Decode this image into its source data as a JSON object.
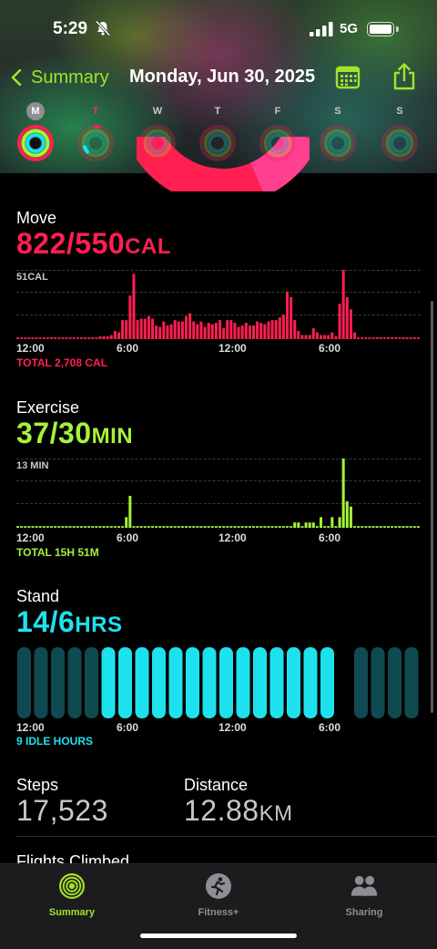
{
  "status_bar": {
    "time": "5:29",
    "network": "5G"
  },
  "header": {
    "back_label": "Summary",
    "date": "Monday, Jun 30, 2025"
  },
  "week": [
    {
      "label": "M",
      "selected": true
    },
    {
      "label": "T",
      "today": true
    },
    {
      "label": "W"
    },
    {
      "label": "T"
    },
    {
      "label": "F"
    },
    {
      "label": "S"
    },
    {
      "label": "S"
    }
  ],
  "colors": {
    "move": "#ff1f50",
    "exercise": "#a6f23a",
    "stand": "#1ee1ee",
    "accent": "#a5e22a"
  },
  "move": {
    "title": "Move",
    "value": "822/550",
    "unit": "CAL",
    "max_label": "51CAL",
    "total": "TOTAL 2,708 CAL",
    "x_labels": [
      "12:00",
      "6:00",
      "12:00",
      "6:00"
    ]
  },
  "exercise": {
    "title": "Exercise",
    "value": "37/30",
    "unit": "MIN",
    "max_label": "13 MIN",
    "total": "TOTAL 15H 51M",
    "x_labels": [
      "12:00",
      "6:00",
      "12:00",
      "6:00"
    ]
  },
  "stand": {
    "title": "Stand",
    "value": "14/6",
    "unit": "HRS",
    "idle": "9 IDLE HOURS",
    "x_labels": [
      "12:00",
      "6:00",
      "12:00",
      "6:00"
    ]
  },
  "steps": {
    "title": "Steps",
    "value": "17,523"
  },
  "distance": {
    "title": "Distance",
    "value": "12.88",
    "unit": "KM"
  },
  "flights": {
    "title": "Flights Climbed"
  },
  "tabs": [
    {
      "label": "Summary",
      "active": true,
      "icon": "activity-rings-icon"
    },
    {
      "label": "Fitness+",
      "icon": "running-figure-icon"
    },
    {
      "label": "Sharing",
      "icon": "people-icon"
    }
  ],
  "chart_data": [
    {
      "type": "bar",
      "title": "Move",
      "unit": "CAL",
      "ylim": [
        0,
        51
      ],
      "x_ticks": [
        "12:00",
        "6:00",
        "12:00",
        "6:00"
      ],
      "values": [
        0,
        0,
        0,
        0,
        0,
        0,
        0,
        0,
        0,
        0,
        0,
        0,
        0,
        0,
        0,
        0,
        0,
        0,
        0,
        0,
        0,
        0,
        2,
        2,
        2,
        3,
        6,
        5,
        14,
        14,
        32,
        48,
        14,
        15,
        15,
        17,
        15,
        10,
        9,
        13,
        10,
        11,
        14,
        13,
        13,
        17,
        19,
        13,
        11,
        13,
        9,
        12,
        11,
        12,
        14,
        8,
        14,
        14,
        12,
        9,
        10,
        12,
        10,
        10,
        13,
        12,
        11,
        13,
        14,
        14,
        16,
        18,
        35,
        31,
        14,
        6,
        3,
        3,
        3,
        8,
        5,
        3,
        3,
        3,
        5,
        2,
        26,
        51,
        31,
        22,
        5,
        0,
        0,
        0,
        0,
        0,
        0,
        0,
        0,
        0,
        0,
        0,
        0,
        0,
        0,
        0,
        0,
        0
      ]
    },
    {
      "type": "bar",
      "title": "Exercise",
      "unit": "MIN",
      "ylim": [
        0,
        13
      ],
      "x_ticks": [
        "12:00",
        "6:00",
        "12:00",
        "6:00"
      ],
      "values": [
        0,
        0,
        0,
        0,
        0,
        0,
        0,
        0,
        0,
        0,
        0,
        0,
        0,
        0,
        0,
        0,
        0,
        0,
        0,
        0,
        0,
        0,
        0,
        0,
        0,
        0,
        0,
        0,
        0,
        2,
        6,
        0,
        0,
        0,
        0,
        0,
        0,
        0,
        0,
        0,
        0,
        0,
        0,
        0,
        0,
        0,
        0,
        0,
        0,
        0,
        0,
        0,
        0,
        0,
        0,
        0,
        0,
        0,
        0,
        0,
        0,
        0,
        0,
        0,
        0,
        0,
        0,
        0,
        0,
        0,
        0,
        0,
        0,
        0,
        1,
        1,
        0,
        1,
        1,
        1,
        0,
        2,
        0,
        0,
        2,
        0,
        2,
        13,
        5,
        4,
        0,
        0,
        0,
        0,
        0,
        0,
        0,
        0,
        0,
        0,
        0,
        0,
        0,
        0,
        0,
        0,
        0,
        0
      ]
    },
    {
      "type": "bar",
      "title": "Stand",
      "unit": "HRS",
      "x_ticks": [
        "12:00",
        "6:00",
        "12:00",
        "6:00"
      ],
      "hours": [
        0,
        0,
        0,
        0,
        0,
        1,
        1,
        1,
        1,
        1,
        1,
        1,
        1,
        1,
        1,
        1,
        1,
        1,
        1,
        0,
        0,
        0,
        0,
        0
      ],
      "hours_without_bar": [
        19
      ]
    }
  ]
}
